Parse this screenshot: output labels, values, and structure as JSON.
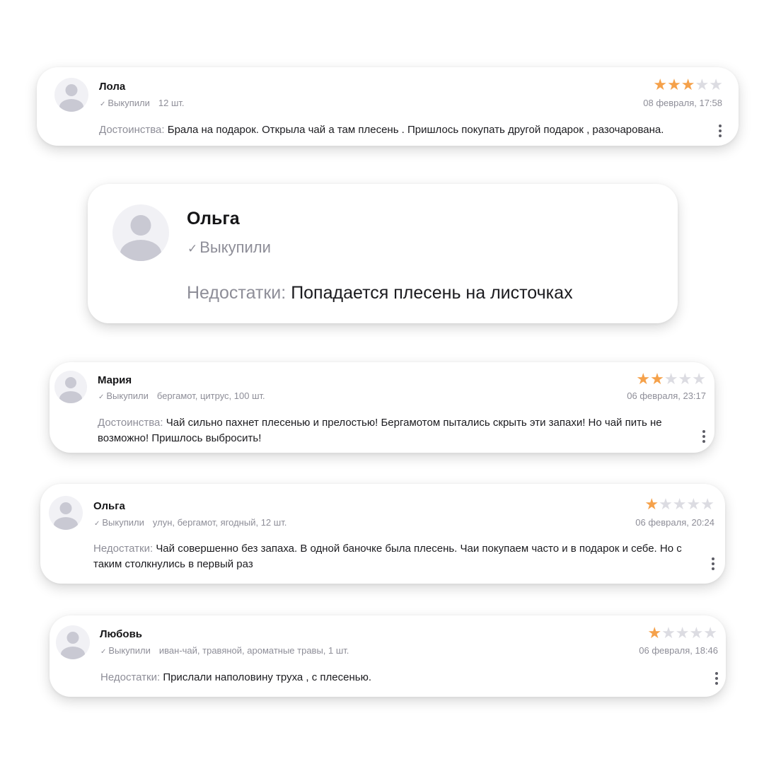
{
  "colors": {
    "star_on": "#f5a14a",
    "star_off": "#dcdce2",
    "muted": "#8e8e98",
    "text": "#1b1b1f"
  },
  "reviews": [
    {
      "author": "Лола",
      "purchase_check": "✓",
      "purchase_label": "Выкупили",
      "variant": "12 шт.",
      "date": "08 февраля, 17:58",
      "rating": 3,
      "rating_max": 5,
      "review_label": "Достоинства:",
      "review_text": "Брала на подарок. Открыла чай а там плесень . Пришлось покупать другой подарок , разочарована."
    },
    {
      "author": "Ольга",
      "purchase_check": "✓",
      "purchase_label": "Выкупили",
      "review_label": "Недостатки:",
      "review_text": "Попадается плесень на листочках"
    },
    {
      "author": "Мария",
      "purchase_check": "✓",
      "purchase_label": "Выкупили",
      "variant": "бергамот, цитрус, 100 шт.",
      "date": "06 февраля, 23:17",
      "rating": 2,
      "rating_max": 5,
      "review_label": "Достоинства:",
      "review_text": "Чай сильно пахнет плесенью и прелостью! Бергамотом пытались скрыть эти запахи! Но чай пить не возможно! Пришлось выбросить!"
    },
    {
      "author": "Ольга",
      "purchase_check": "✓",
      "purchase_label": "Выкупили",
      "variant": "улун, бергамот, ягодный, 12 шт.",
      "date": "06 февраля, 20:24",
      "rating": 1,
      "rating_max": 5,
      "review_label": "Недостатки:",
      "review_text": "Чай совершенно без запаха. В одной баночке была плесень. Чаи покупаем часто и в подарок и себе. Но с таким столкнулись в первый раз"
    },
    {
      "author": "Любовь",
      "purchase_check": "✓",
      "purchase_label": "Выкупили",
      "variant": "иван-чай, травяной, ароматные травы, 1 шт.",
      "date": "06 февраля, 18:46",
      "rating": 1,
      "rating_max": 5,
      "review_label": "Недостатки:",
      "review_text": "Прислали наполовину труха , с плесенью."
    }
  ]
}
